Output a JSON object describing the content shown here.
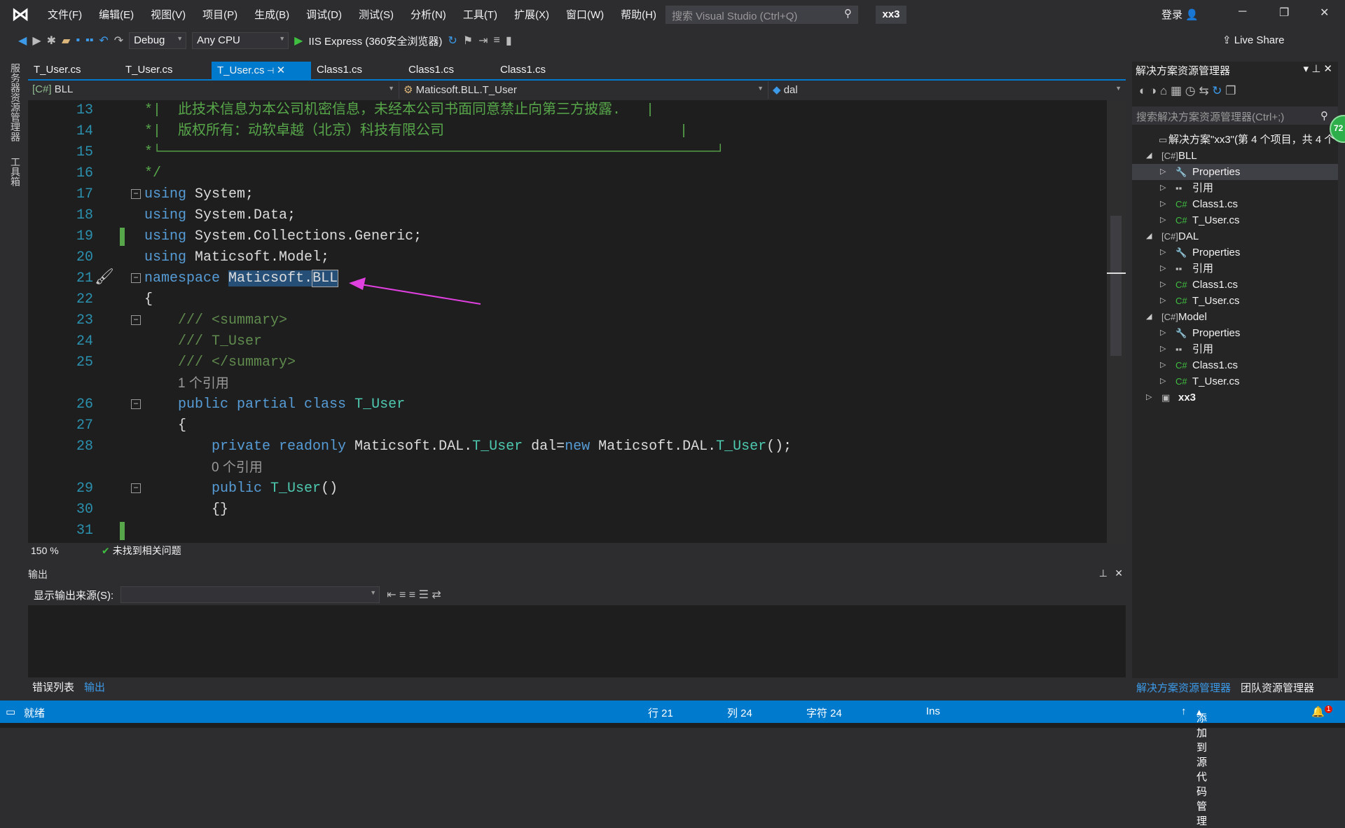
{
  "title": {
    "menus": [
      "文件(F)",
      "编辑(E)",
      "视图(V)",
      "项目(P)",
      "生成(B)",
      "调试(D)",
      "测试(S)",
      "分析(N)",
      "工具(T)",
      "扩展(X)",
      "窗口(W)",
      "帮助(H)"
    ],
    "search_placeholder": "搜索 Visual Studio (Ctrl+Q)",
    "solution": "xx3",
    "login": "登录"
  },
  "toolbar": {
    "config": "Debug",
    "platform": "Any CPU",
    "run": "IIS Express (360安全浏览器)",
    "live_share": "Live Share"
  },
  "side_tabs": [
    "服务器资源管理器",
    "工具箱"
  ],
  "tabs": [
    {
      "label": "T_User.cs"
    },
    {
      "label": "T_User.cs"
    },
    {
      "label": "T_User.cs",
      "active": true
    },
    {
      "label": "Class1.cs"
    },
    {
      "label": "Class1.cs"
    },
    {
      "label": "Class1.cs"
    }
  ],
  "nav": {
    "project": "BLL",
    "type": "Maticsoft.BLL.T_User",
    "member": "dal"
  },
  "code": [
    {
      "n": "13",
      "t": [
        [
          "*|  此技术信息为本公司机密信息，未经本公司书面同意禁止向第三方披露.   |",
          "cm"
        ]
      ]
    },
    {
      "n": "14",
      "t": [
        [
          "*|  版权所有：动软卓越（北京）科技有限公司                            |",
          "cm"
        ]
      ]
    },
    {
      "n": "15",
      "t": [
        [
          "*└──────────────────────────────────────────────────────────────────┘",
          "cm"
        ]
      ]
    },
    {
      "n": "16",
      "t": [
        [
          "*/",
          "cm"
        ]
      ]
    },
    {
      "n": "17",
      "fold": true,
      "t": [
        [
          "using",
          "kw"
        ],
        [
          " System;",
          "tx"
        ]
      ]
    },
    {
      "n": "18",
      "t": [
        [
          "using",
          "kw"
        ],
        [
          " System.Data;",
          "tx"
        ]
      ]
    },
    {
      "n": "19",
      "chg": true,
      "t": [
        [
          "using",
          "kw"
        ],
        [
          " System.Collections.Generic;",
          "tx"
        ]
      ]
    },
    {
      "n": "20",
      "t": [
        [
          "using",
          "kw"
        ],
        [
          " Maticsoft.Model;",
          "tx"
        ]
      ]
    },
    {
      "n": "21",
      "fold": true,
      "t": [
        [
          "namespace",
          "kw"
        ],
        [
          " ",
          "tx"
        ],
        [
          "Maticsoft.",
          "tx sel"
        ],
        [
          "BLL",
          "tx box"
        ]
      ]
    },
    {
      "n": "22",
      "t": [
        [
          "{",
          "tx"
        ]
      ]
    },
    {
      "n": "23",
      "fold": true,
      "t": [
        [
          "    /// <summary>",
          "doc"
        ]
      ]
    },
    {
      "n": "24",
      "t": [
        [
          "    /// T_User",
          "doc"
        ]
      ]
    },
    {
      "n": "25",
      "t": [
        [
          "    /// </summary>",
          "doc"
        ]
      ]
    },
    {
      "n": "",
      "t": [
        [
          "    ",
          "tx"
        ],
        [
          "1 个引用",
          "lens"
        ]
      ]
    },
    {
      "n": "26",
      "fold": true,
      "t": [
        [
          "    public partial class",
          "kw"
        ],
        [
          " ",
          "tx"
        ],
        [
          "T_User",
          "ty"
        ]
      ]
    },
    {
      "n": "27",
      "t": [
        [
          "    {",
          "tx"
        ]
      ]
    },
    {
      "n": "28",
      "t": [
        [
          "        private readonly",
          "kw"
        ],
        [
          " Maticsoft.DAL.",
          "tx"
        ],
        [
          "T_User",
          "ty"
        ],
        [
          " dal=",
          "tx"
        ],
        [
          "new",
          "kw"
        ],
        [
          " Maticsoft.DAL.",
          "tx"
        ],
        [
          "T_User",
          "ty"
        ],
        [
          "();",
          "tx"
        ]
      ]
    },
    {
      "n": "",
      "t": [
        [
          "        ",
          "tx"
        ],
        [
          "0 个引用",
          "lens"
        ]
      ]
    },
    {
      "n": "29",
      "fold": true,
      "t": [
        [
          "        public",
          "kw"
        ],
        [
          " ",
          "tx"
        ],
        [
          "T_User",
          "ty"
        ],
        [
          "()",
          "tx"
        ]
      ]
    },
    {
      "n": "30",
      "t": [
        [
          "        {}",
          "tx"
        ]
      ]
    },
    {
      "n": "31",
      "chg": true,
      "t": [
        [
          "",
          "tx"
        ]
      ]
    }
  ],
  "editor_status": {
    "zoom": "150 %",
    "issues": "未找到相关问题"
  },
  "output": {
    "title": "输出",
    "source_label": "显示输出来源(S):"
  },
  "bottom_tabs": [
    "错误列表",
    "输出"
  ],
  "solution_explorer": {
    "title": "解决方案资源管理器",
    "search_placeholder": "搜索解决方案资源管理器(Ctrl+;)",
    "badge": "72",
    "rows": [
      {
        "label": "解决方案\"xx3\"(第 4 个项目，共 4 个",
        "level": 0,
        "icon": "solution-icon"
      },
      {
        "label": "BLL",
        "level": 1,
        "icon": "csharp-project-icon",
        "exp": "open"
      },
      {
        "label": "Properties",
        "level": 2,
        "icon": "wrench-icon",
        "exp": "closed",
        "hl": true
      },
      {
        "label": "引用",
        "level": 2,
        "icon": "references-icon",
        "exp": "closed"
      },
      {
        "label": "Class1.cs",
        "level": 2,
        "icon": "csharp-file-icon",
        "exp": "closed"
      },
      {
        "label": "T_User.cs",
        "level": 2,
        "icon": "csharp-file-icon",
        "exp": "closed"
      },
      {
        "label": "DAL",
        "level": 1,
        "icon": "csharp-project-icon",
        "exp": "open"
      },
      {
        "label": "Properties",
        "level": 2,
        "icon": "wrench-icon",
        "exp": "closed"
      },
      {
        "label": "引用",
        "level": 2,
        "icon": "references-icon",
        "exp": "closed"
      },
      {
        "label": "Class1.cs",
        "level": 2,
        "icon": "csharp-file-icon",
        "exp": "closed"
      },
      {
        "label": "T_User.cs",
        "level": 2,
        "icon": "csharp-file-icon",
        "exp": "closed"
      },
      {
        "label": "Model",
        "level": 1,
        "icon": "csharp-project-icon",
        "exp": "open"
      },
      {
        "label": "Properties",
        "level": 2,
        "icon": "wrench-icon",
        "exp": "closed"
      },
      {
        "label": "引用",
        "level": 2,
        "icon": "references-icon",
        "exp": "closed"
      },
      {
        "label": "Class1.cs",
        "level": 2,
        "icon": "csharp-file-icon",
        "exp": "closed"
      },
      {
        "label": "T_User.cs",
        "level": 2,
        "icon": "csharp-file-icon",
        "exp": "closed"
      },
      {
        "label": "xx3",
        "level": 1,
        "icon": "web-project-icon",
        "exp": "closed",
        "bold": true
      }
    ],
    "bottom_tabs": [
      "解决方案资源管理器",
      "团队资源管理器"
    ]
  },
  "status": {
    "ready": "就绪",
    "line": "行 21",
    "col": "列 24",
    "char": "字符 24",
    "mode": "Ins",
    "source_control": "添加到源代码管理",
    "notifications": "1"
  },
  "colors": {
    "accent": "#007acc",
    "arrow": "#e040e0"
  }
}
